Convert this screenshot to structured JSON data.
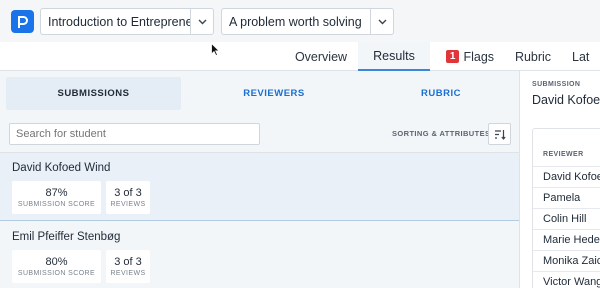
{
  "header": {
    "logo_letter": "P",
    "course_select": "Introduction to Entrepreneu...",
    "assignment_select": "A problem worth solving"
  },
  "tabs": [
    {
      "label": "Overview"
    },
    {
      "label": "Results"
    },
    {
      "label": "Flags",
      "badge": "1"
    },
    {
      "label": "Rubric"
    },
    {
      "label": "Lat"
    }
  ],
  "subtabs": {
    "submissions": "SUBMISSIONS",
    "reviewers": "REVIEWERS",
    "rubric": "RUBRIC"
  },
  "search": {
    "placeholder": "Search for student"
  },
  "sorting_label": "SORTING & ATTRIBUTES",
  "submissions": [
    {
      "name": "David Kofoed Wind",
      "score": "87%",
      "score_label": "SUBMISSION SCORE",
      "reviews": "3 of 3",
      "reviews_label": "REVIEWS"
    },
    {
      "name": "Emil Pfeiffer Stenbøg",
      "score": "80%",
      "score_label": "SUBMISSION SCORE",
      "reviews": "3 of 3",
      "reviews_label": "REVIEWS"
    }
  ],
  "detail": {
    "submission_label": "SUBMISSION",
    "submission_name": "David Kofoed",
    "reviewer_header": "REVIEWER",
    "reviewers": [
      "David Kofoe",
      "Pamela",
      "Colin Hill",
      "Marie Heder",
      "Monika Zaic",
      "Victor Wang"
    ]
  },
  "colors": {
    "accent": "#1a73e8",
    "flag": "#e0363a",
    "selected_bg": "#e9f0f8"
  }
}
